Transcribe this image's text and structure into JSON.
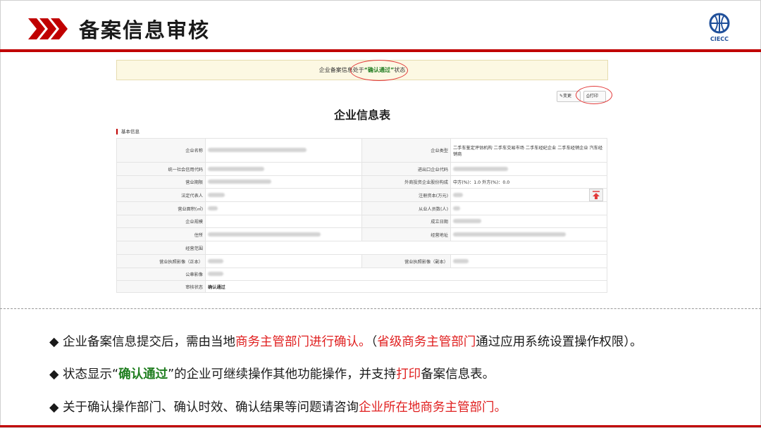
{
  "slide": {
    "title": "备案信息审核"
  },
  "logo": {
    "text": "CIECC"
  },
  "status_bar": {
    "prefix": "企业备案信息处于",
    "status": "“确认通过”",
    "suffix": "状态"
  },
  "toolbar": {
    "change_label": "变更",
    "print_label": "打印"
  },
  "form": {
    "title": "企业信息表",
    "section": "基本信息",
    "rows": [
      {
        "l1": "企业名称",
        "v1": "",
        "l2": "企业类型",
        "v2": "二手车鉴定评估机构 二手车交易市场 二手车经纪企业 二手车经销企业 汽车经销商"
      },
      {
        "l1": "统一社会信用代码",
        "v1": "",
        "l2": "进出口企业代码",
        "v2": ""
      },
      {
        "l1": "营业期限",
        "v1": "",
        "l2": "外商投资企业股份构成",
        "v2": "中方(%)：1.0  外方(%)：0.0"
      },
      {
        "l1": "法定代表人",
        "v1": "",
        "l2": "注册资本(万元)",
        "v2": ""
      },
      {
        "l1": "营业面积(㎡)",
        "v1": "",
        "l2": "从业人员数(人)",
        "v2": ""
      },
      {
        "l1": "企业规模",
        "v1": "",
        "l2": "成立日期",
        "v2": ""
      },
      {
        "l1": "住所",
        "v1": "",
        "l2": "经营地址",
        "v2": ""
      },
      {
        "l1": "经营范围",
        "v1": ""
      },
      {
        "l1": "营业执照影像（正本）",
        "v1": "",
        "l2": "营业执照影像（副本）",
        "v2": ""
      },
      {
        "l1": "公章影像",
        "v1": ""
      },
      {
        "l1": "审核状态",
        "v1": "确认通过"
      }
    ]
  },
  "bullets": {
    "b1": {
      "t1": "企业备案信息提交后，需由当地",
      "t2": "商务主管部门进行确认。",
      "t3": "（",
      "t4": "省级商务主管部门",
      "t5": "通过应用系统设置操作权限）。"
    },
    "b2": {
      "t1": "状态显示“",
      "t2": "确认通过",
      "t3": "”的企业可继续操作其他功能操作，并支持",
      "t4": "打印",
      "t5": "备案信息表。"
    },
    "b3": {
      "t1": "关于确认操作部门、确认时效、确认结果等问题请咨询",
      "t2": "企业所在地商务主管部门。"
    }
  },
  "colors": {
    "accent": "#c00000",
    "highlight_red": "#e02020",
    "highlight_green": "#1e7d1e"
  }
}
